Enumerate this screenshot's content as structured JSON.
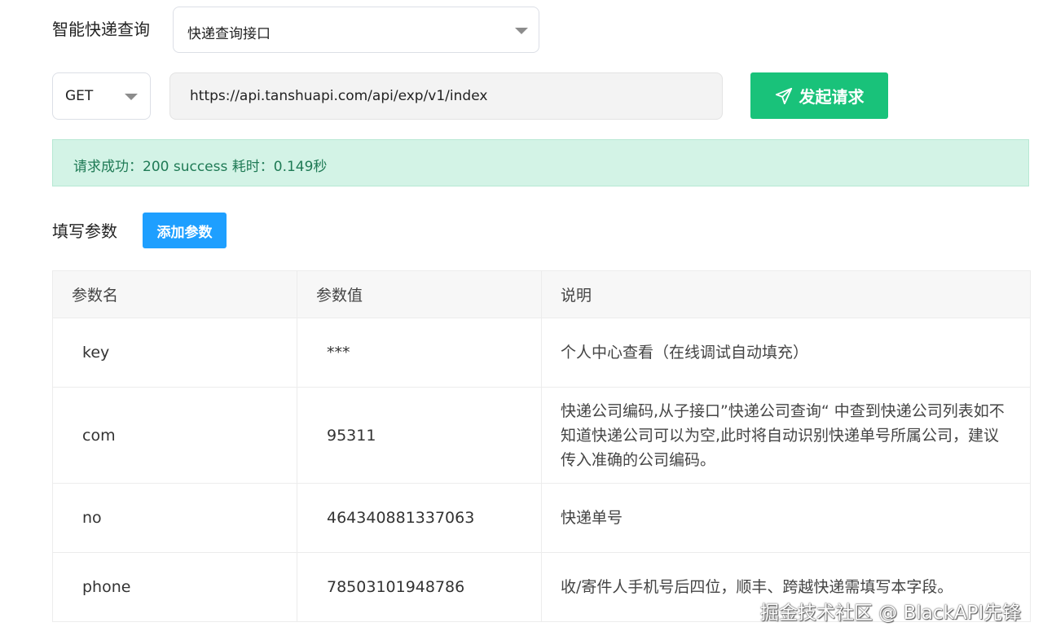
{
  "service_label": "智能快递查询",
  "service_select": {
    "value": "快递查询接口"
  },
  "method_select": {
    "value": "GET"
  },
  "url": "https://api.tanshuapi.com/api/exp/v1/index",
  "send_button": {
    "label": "发起请求",
    "icon": "paper-plane-icon"
  },
  "alert": {
    "text": "请求成功：200 success 耗时：0.149秒"
  },
  "params_label": "填写参数",
  "add_param_button": "添加参数",
  "table": {
    "headers": [
      "参数名",
      "参数值",
      "说明"
    ],
    "rows": [
      {
        "name": "key",
        "value": "***",
        "desc": "个人中心查看（在线调试自动填充）"
      },
      {
        "name": "com",
        "value": "95311",
        "desc": "快递公司编码,从子接口”快递公司查询“ 中查到快递公司列表如不知道快递公司可以为空,此时将自动识别快递单号所属公司，建议传入准确的公司编码。"
      },
      {
        "name": "no",
        "value": "464340881337063",
        "desc": "快递单号"
      },
      {
        "name": "phone",
        "value": "78503101948786",
        "desc": "收/寄件人手机号后四位，顺丰、跨越快递需填写本字段。"
      }
    ]
  },
  "watermark": "掘金技术社区 @ BlackAPI先锋",
  "colors": {
    "primary_green": "#19c27a",
    "primary_blue": "#1e9fff",
    "alert_bg": "#d3f3e6",
    "alert_text": "#1f7a55"
  }
}
